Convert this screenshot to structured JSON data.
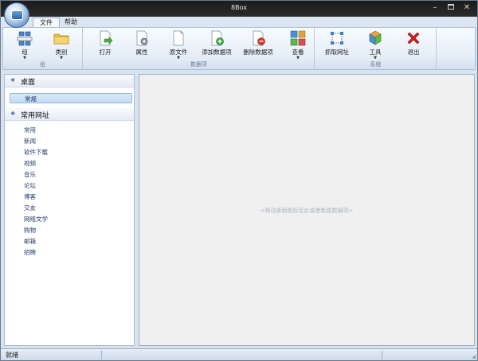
{
  "window": {
    "title": "8Box"
  },
  "menu_tabs": [
    {
      "label": "文件",
      "active": true
    },
    {
      "label": "帮助",
      "active": false
    }
  ],
  "ribbon": {
    "groups": [
      {
        "label": "组",
        "buttons": [
          {
            "label": "组",
            "icon": "group-icon",
            "dropdown": true
          },
          {
            "label": "类别",
            "icon": "folder-icon",
            "dropdown": true
          }
        ]
      },
      {
        "label": "数据项",
        "buttons": [
          {
            "label": "打开",
            "icon": "open-icon",
            "dropdown": false
          },
          {
            "label": "属性",
            "icon": "properties-icon",
            "dropdown": false
          },
          {
            "label": "原文件",
            "icon": "source-file-icon",
            "dropdown": true
          },
          {
            "label": "添加数据项",
            "icon": "add-item-icon",
            "dropdown": false
          },
          {
            "label": "删除数据项",
            "icon": "delete-item-icon",
            "dropdown": false
          },
          {
            "label": "查看",
            "icon": "view-icon",
            "dropdown": true
          }
        ]
      },
      {
        "label": "系统",
        "buttons": [
          {
            "label": "抓取网址",
            "icon": "capture-url-icon",
            "dropdown": false
          },
          {
            "label": "工具",
            "icon": "tools-icon",
            "dropdown": true
          },
          {
            "label": "退出",
            "icon": "exit-icon",
            "dropdown": false
          }
        ]
      }
    ]
  },
  "sidebar": {
    "desktop_header": "桌面",
    "desktop_items": [
      {
        "label": "常规",
        "selected": true
      }
    ],
    "sites_header": "常用网址",
    "site_items": [
      "常用",
      "新闻",
      "软件下载",
      "视频",
      "音乐",
      "论坛",
      "博客",
      "交友",
      "网络文学",
      "购物",
      "邮箱",
      "招聘"
    ]
  },
  "content": {
    "hint": "<将动桌面图标至此或者新建数据项>"
  },
  "status": {
    "text": "就绪"
  },
  "colors": {
    "accent": "#c3dcf5",
    "exit_red": "#d61f1f"
  }
}
